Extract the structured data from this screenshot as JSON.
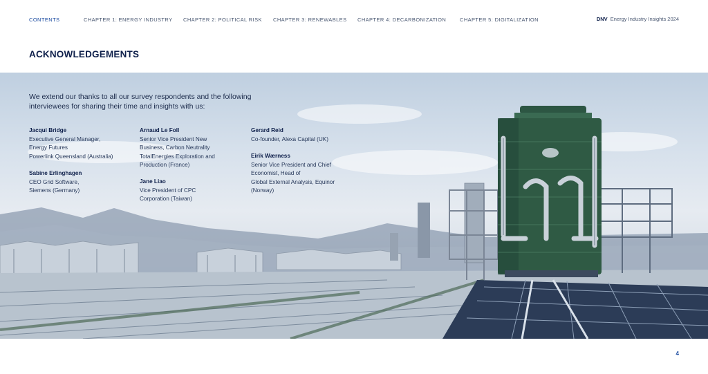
{
  "nav": {
    "contents": "CONTENTS",
    "chapter1": "CHAPTER 1: ENERGY INDUSTRY",
    "chapter2": "CHAPTER 2: POLITICAL RISK",
    "chapter3": "CHAPTER 3: RENEWABLES",
    "chapter4": "CHAPTER 4: DECARBONIZATION",
    "chapter5": "CHAPTER 5: DIGITALIZATION"
  },
  "brand": {
    "logo": "DNV",
    "publication": "Energy Industry Insights 2024"
  },
  "page_title": "ACKNOWLEDGEMENTS",
  "intro": "We extend our thanks to all our survey respondents and the following interviewees for sharing their time and insights with us:",
  "people": {
    "jacqui": {
      "name": "Jacqui Bridge",
      "role": "Executive General Manager,\nEnergy Futures\nPowerlink Queensland (Australia)"
    },
    "sabine": {
      "name": "Sabine Erlinghagen",
      "role": "CEO Grid Software,\nSiemens (Germany)"
    },
    "arnaud": {
      "name": "Arnaud Le Foll",
      "role": "Senior Vice President New\nBusiness, Carbon Neutrality\nTotalEnergies Exploration and\nProduction (France)"
    },
    "jane": {
      "name": "Jane Liao",
      "role": "Vice President of CPC\nCorporation (Taiwan)"
    },
    "gerard": {
      "name": "Gerard Reid",
      "role": "Co-founder, Alexa Capital (UK)"
    },
    "eirik": {
      "name": "Eirik Wærness",
      "role": "Senior Vice President and Chief\nEconomist, Head of\nGlobal External Analysis, Equinor\n(Norway)"
    }
  },
  "page_number": "4",
  "colors": {
    "navy": "#0f204b",
    "accent_blue": "#1a4aa0",
    "tank_green": "#2f5a44"
  }
}
